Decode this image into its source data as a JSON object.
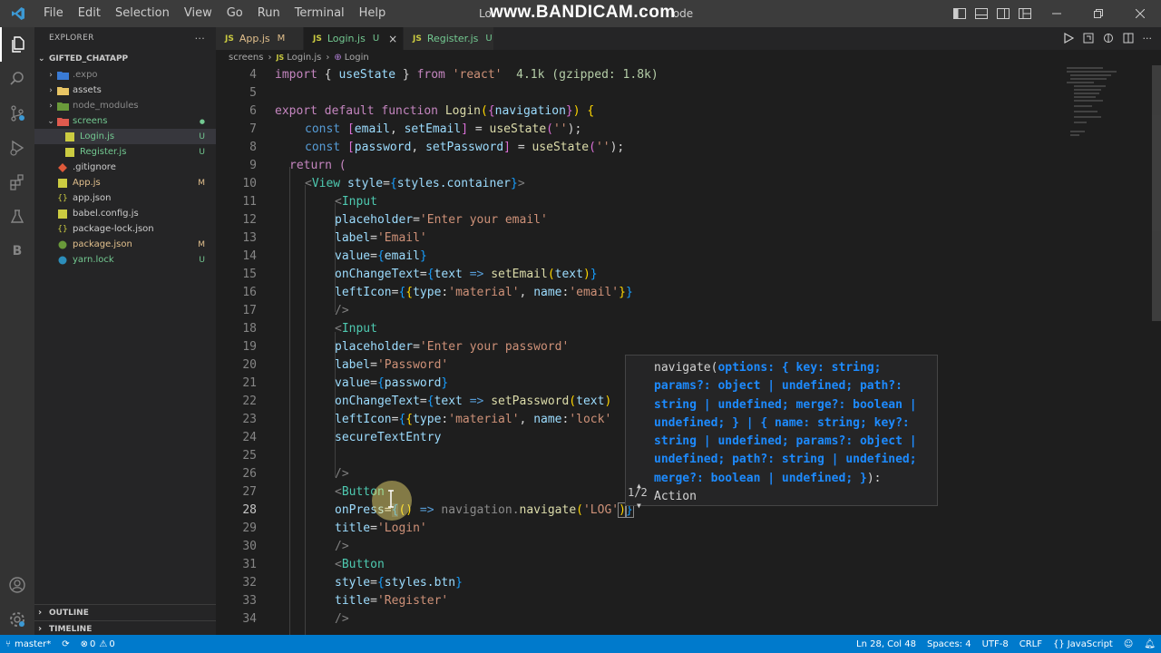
{
  "menu": [
    "File",
    "Edit",
    "Selection",
    "View",
    "Go",
    "Run",
    "Terminal",
    "Help"
  ],
  "window_title": "Lo",
  "window_title_tail": "ode",
  "watermark": "www.BANDICAM.com",
  "explorer": {
    "header": "EXPLORER",
    "more": "···",
    "root": "GIFTED_CHATAPP",
    "items": [
      {
        "name": ".expo",
        "status": "",
        "kind": "folder"
      },
      {
        "name": "assets",
        "status": "",
        "kind": "folder"
      },
      {
        "name": "node_modules",
        "status": "",
        "kind": "folder"
      },
      {
        "name": "screens",
        "status": "●",
        "kind": "folder-open"
      },
      {
        "name": "Login.js",
        "status": "U",
        "kind": "js"
      },
      {
        "name": "Register.js",
        "status": "U",
        "kind": "js"
      },
      {
        "name": ".gitignore",
        "status": "",
        "kind": "git"
      },
      {
        "name": "App.js",
        "status": "M",
        "kind": "js"
      },
      {
        "name": "app.json",
        "status": "",
        "kind": "json"
      },
      {
        "name": "babel.config.js",
        "status": "",
        "kind": "js"
      },
      {
        "name": "package-lock.json",
        "status": "",
        "kind": "json"
      },
      {
        "name": "package.json",
        "status": "M",
        "kind": "json"
      },
      {
        "name": "yarn.lock",
        "status": "U",
        "kind": "yarn"
      }
    ],
    "outline": "OUTLINE",
    "timeline": "TIMELINE"
  },
  "tabs": [
    {
      "label": "App.js",
      "status": "M"
    },
    {
      "label": "Login.js",
      "status": "U"
    },
    {
      "label": "Register.js",
      "status": "U"
    }
  ],
  "breadcrumb": {
    "folder": "screens",
    "file": "Login.js",
    "symbol": "Login"
  },
  "line_numbers": [
    "4",
    "5",
    "6",
    "7",
    "8",
    "9",
    "10",
    "11",
    "12",
    "13",
    "14",
    "15",
    "16",
    "17",
    "18",
    "19",
    "20",
    "21",
    "22",
    "23",
    "24",
    "25",
    "26",
    "27",
    "28",
    "29",
    "30",
    "31",
    "32",
    "33",
    "34"
  ],
  "code": {
    "l4_import": "import",
    "l4_a": " { ",
    "l4_usestate": "useState",
    "l4_b": " } ",
    "l4_from": "from",
    "l4_c": " ",
    "l4_react": "'react'",
    "l4_hint": "  4.1k (gzipped: 1.8k)",
    "l6_export": "export default function ",
    "l6_fn": "Login",
    "l6_a": "(",
    "l6_b": "{",
    "l6_nav": "navigation",
    "l6_c": "}",
    "l6_d": ")",
    "l6_e": " {",
    "l7": [
      "const ",
      "[",
      "email",
      ", ",
      "setEmail",
      "]",
      " = ",
      "useState",
      "(",
      "''",
      ");"
    ],
    "l8": [
      "const ",
      "[",
      "password",
      ", ",
      "setPassword",
      "]",
      " = ",
      "useState",
      "(",
      "''",
      ");"
    ],
    "l9": "return (",
    "l10": [
      "<",
      "View",
      " style",
      "=",
      "{",
      "styles.container",
      "}",
      ">"
    ],
    "l11": [
      "<",
      "Input"
    ],
    "l12": [
      "placeholder",
      "=",
      "'Enter your email'"
    ],
    "l13": [
      "label",
      "=",
      "'Email'"
    ],
    "l14": [
      "value",
      "=",
      "{",
      "email",
      "}"
    ],
    "l15": [
      "onChangeText",
      "=",
      "{",
      "text",
      " => ",
      "setEmail",
      "(",
      "text",
      ")",
      "}"
    ],
    "l16": [
      "leftIcon",
      "=",
      "{",
      "{",
      "type",
      ":",
      "'material'",
      ", ",
      "name",
      ":",
      "'email'",
      "}",
      "}"
    ],
    "l17": "/>",
    "l18": [
      "<",
      "Input"
    ],
    "l19": [
      "placeholder",
      "=",
      "'Enter your password'"
    ],
    "l20": [
      "label",
      "=",
      "'Password'"
    ],
    "l21": [
      "value",
      "=",
      "{",
      "password",
      "}"
    ],
    "l22": [
      "onChangeText",
      "=",
      "{",
      "text",
      " => ",
      "setPassword",
      "(",
      "text",
      ")"
    ],
    "l23": [
      "leftIcon",
      "=",
      "{",
      "{",
      "type",
      ":",
      "'material'",
      ", ",
      "name",
      ":",
      "'lock'"
    ],
    "l24": "secureTextEntry",
    "l26": "/>",
    "l27": [
      "<",
      "Button"
    ],
    "l28": [
      "onPress",
      "=",
      "{",
      "(",
      ")",
      " => ",
      "navigation",
      ".",
      "navigate",
      "(",
      "'LOG'",
      ")",
      "}"
    ],
    "l29": [
      "title",
      "=",
      "'Login'"
    ],
    "l30": "/>",
    "l31": [
      "<",
      "Button"
    ],
    "l32": [
      "style",
      "=",
      "{",
      "styles.btn",
      "}"
    ],
    "l33": [
      "title",
      "=",
      "'Register'"
    ],
    "l34": "/>"
  },
  "hover": {
    "lines": [
      [
        "navigate(",
        "options: { key: string;"
      ],
      [
        "params?: object | undefined; path?:",
        ""
      ],
      [
        "string | undefined; merge?: boolean |",
        ""
      ],
      [
        "undefined; } | { name: string; key?:",
        ""
      ],
      [
        "string | undefined; params?: object |",
        ""
      ],
      [
        "undefined; path?: string | undefined;",
        ""
      ],
      [
        "merge?: boolean | undefined; }",
        "):"
      ],
      [
        "",
        "Action"
      ]
    ],
    "page": "1/2"
  },
  "status": {
    "branch": "master*",
    "errors": "0",
    "warnings": "0",
    "position": "Ln 28, Col 48",
    "spaces": "Spaces: 4",
    "encoding": "UTF-8",
    "eol": "CRLF",
    "language": "JavaScript"
  },
  "colors": {
    "accent": "#007acc",
    "editor_bg": "#1e1e1e",
    "sidebar_bg": "#252526",
    "untracked": "#73c991",
    "modified": "#e2c08d"
  }
}
